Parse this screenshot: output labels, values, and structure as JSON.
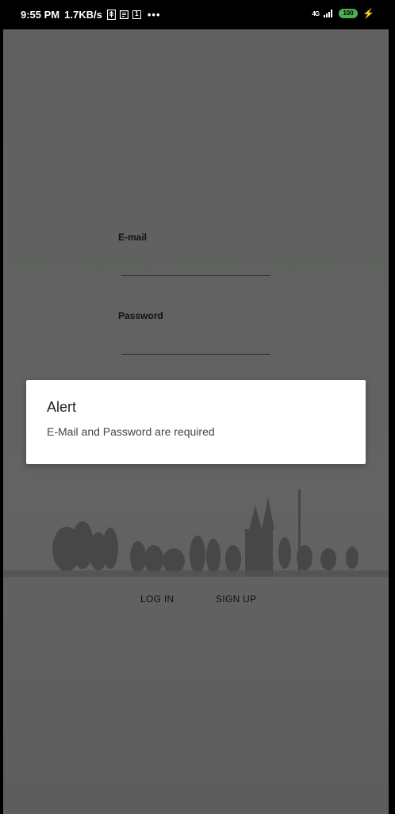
{
  "status_bar": {
    "time": "9:55 PM",
    "speed": "1.7KB/s",
    "icons_left": [
      "usb-icon",
      "notes-icon",
      "calendar-icon"
    ],
    "calendar_day": "1",
    "more": "•••",
    "network": "4G",
    "battery": "100",
    "charging_icon": "bolt-icon"
  },
  "form": {
    "email_label": "E-mail",
    "email_value": "",
    "password_label": "Password",
    "password_value": ""
  },
  "actions": {
    "login_label": "LOG IN",
    "signup_label": "SIGN UP"
  },
  "dialog": {
    "title": "Alert",
    "message": "E-Mail and Password are required"
  },
  "colors": {
    "scrim": "#626362",
    "dialog_bg": "#ffffff",
    "battery": "#4caf50"
  }
}
